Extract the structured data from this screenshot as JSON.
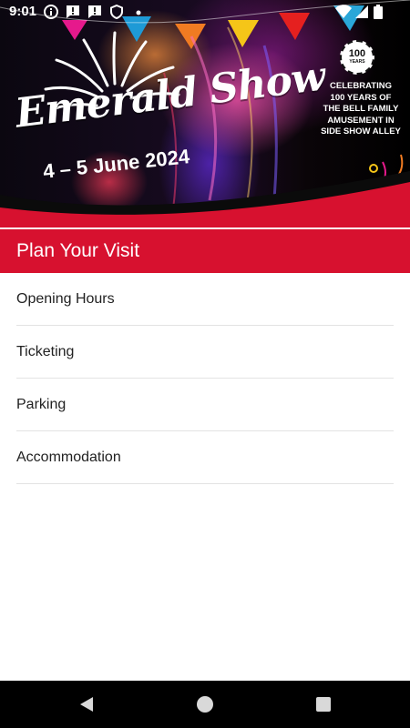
{
  "status_bar": {
    "time": "9:01",
    "left_icons": [
      "info-icon",
      "alert-icon",
      "alert-icon",
      "vpn-shield-icon",
      "dot-icon"
    ],
    "right_icons": [
      "wifi-icon",
      "cellular-signal-icon",
      "battery-icon"
    ]
  },
  "hero": {
    "show_title": "Emerald Show",
    "dates": "4 – 5 June 2024",
    "badge_number": "100",
    "badge_caption": "YEARS",
    "celebration_lines": [
      "CELEBRATING",
      "100 YEARS OF",
      "THE BELL FAMILY",
      "AMUSEMENT IN",
      "SIDE SHOW ALLEY"
    ]
  },
  "section": {
    "title": "Plan Your Visit"
  },
  "menu": {
    "items": [
      {
        "label": "Opening Hours"
      },
      {
        "label": "Ticketing"
      },
      {
        "label": "Parking"
      },
      {
        "label": "Accommodation"
      }
    ]
  },
  "nav_bar": {
    "buttons": [
      "back-icon",
      "home-icon",
      "recents-icon"
    ]
  },
  "colors": {
    "header_red": "#d7112f",
    "nav_black": "#000000",
    "text": "#222222"
  }
}
